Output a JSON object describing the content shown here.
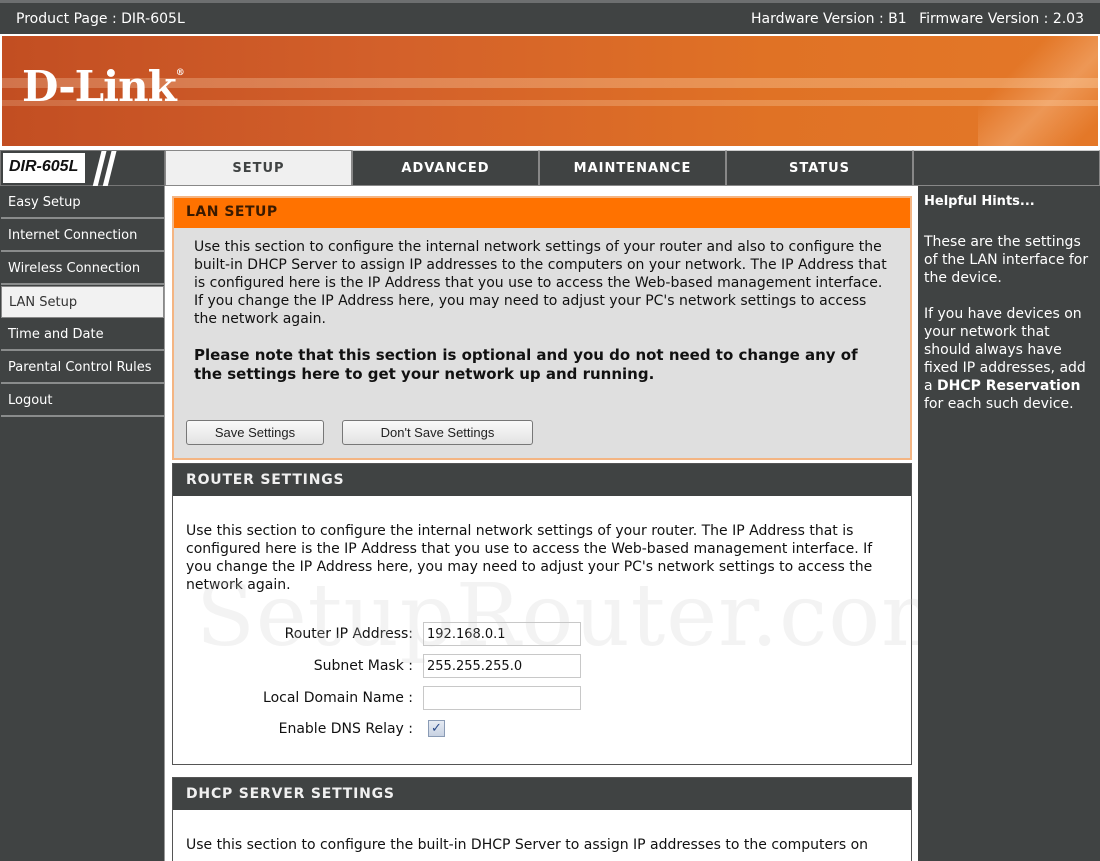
{
  "topbar": {
    "product_page": "Product Page : DIR-605L",
    "hardware_version": "Hardware Version : B1",
    "firmware_version": "Firmware Version : 2.03"
  },
  "banner": {
    "logo_text": "D-Link",
    "registered_mark": "®"
  },
  "nav": {
    "model": "DIR-605L",
    "tabs": [
      {
        "label": "SETUP",
        "active": true
      },
      {
        "label": "ADVANCED",
        "active": false
      },
      {
        "label": "MAINTENANCE",
        "active": false
      },
      {
        "label": "STATUS",
        "active": false
      }
    ]
  },
  "sidebar": {
    "items": [
      {
        "label": "Easy Setup",
        "active": false
      },
      {
        "label": "Internet Connection",
        "active": false
      },
      {
        "label": "Wireless Connection",
        "active": false
      },
      {
        "label": "LAN Setup",
        "active": true
      },
      {
        "label": "Time and Date",
        "active": false
      },
      {
        "label": "Parental Control Rules",
        "active": false
      },
      {
        "label": "Logout",
        "active": false
      }
    ]
  },
  "lan_setup": {
    "title": "LAN SETUP",
    "description": "Use this section to configure the internal network settings of your router and also to configure the built-in DHCP Server to assign IP addresses to the computers on your network. The IP Address that is configured here is the IP Address that you use to access the Web-based management interface. If you change the IP Address here, you may need to adjust your PC's network settings to access the network again.",
    "note": "Please note that this section is optional and you do not need to change any of the settings here to get your network up and running.",
    "save_label": "Save Settings",
    "dont_save_label": "Don't Save Settings"
  },
  "router_settings": {
    "title": "ROUTER SETTINGS",
    "description": "Use this section to configure the internal network settings of your router. The IP Address that is configured here is the IP Address that you use to access the Web-based management interface. If you change the IP Address here, you may need to adjust your PC's network settings to access the network again.",
    "fields": {
      "router_ip_label": "Router IP Address:",
      "router_ip_value": "192.168.0.1",
      "subnet_label": "Subnet Mask :",
      "subnet_value": "255.255.255.0",
      "domain_label": "Local Domain Name :",
      "domain_value": "",
      "dns_relay_label": "Enable DNS Relay :",
      "dns_relay_checked": true
    }
  },
  "dhcp_settings": {
    "title": "DHCP SERVER SETTINGS",
    "description": "Use this section to configure the built-in DHCP Server to assign IP addresses to the computers on"
  },
  "hints": {
    "title": "Helpful Hints...",
    "p1": "These are the settings of the LAN interface for the device.",
    "p2_before": "If you have devices on your network that should always have fixed IP addresses, add a ",
    "p2_bold": "DHCP Reservation",
    "p2_after": " for each such device."
  },
  "watermark": "SetupRouter.com",
  "colors": {
    "accent_orange": "#ff7200",
    "dark_gray": "#404343"
  }
}
